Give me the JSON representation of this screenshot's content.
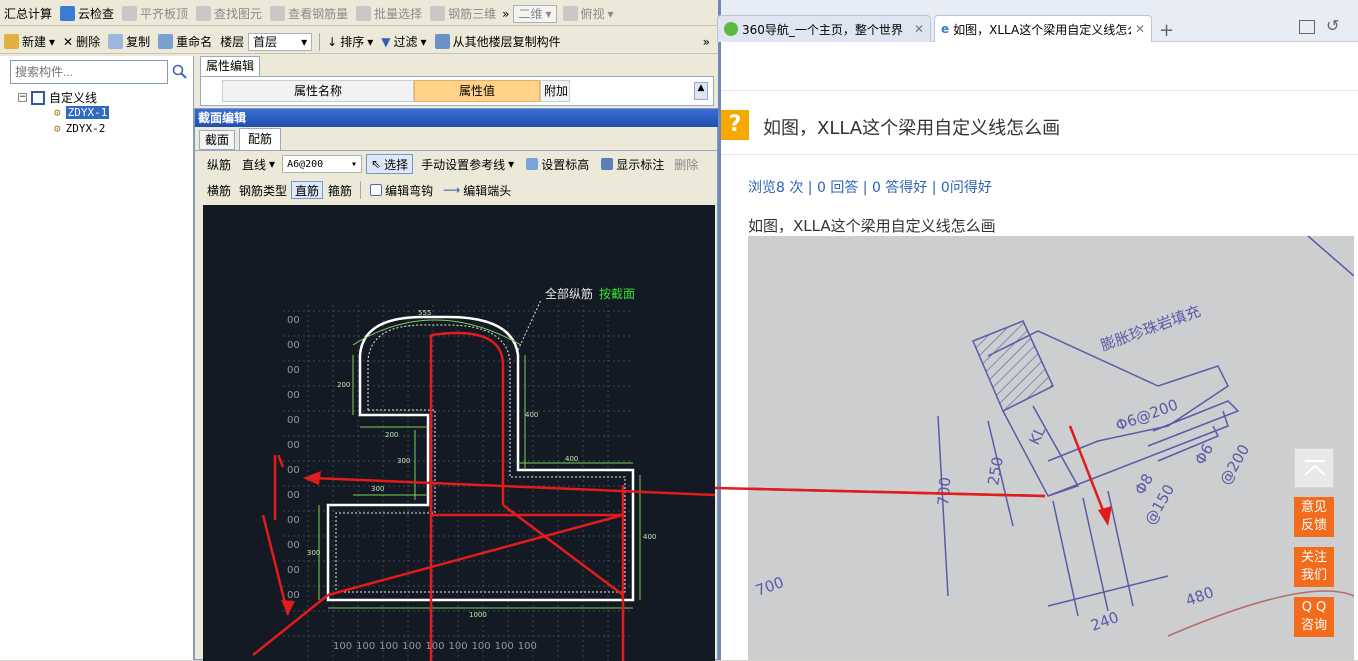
{
  "left_app": {
    "toolbar1": {
      "items": [
        "汇总计算",
        "云检查",
        "平齐板顶",
        "查找图元",
        "查看钢筋量",
        "批量选择",
        "钢筋三维"
      ],
      "view_mode": "二维",
      "view_dir": "俯视"
    },
    "toolbar2": {
      "items": [
        "新建",
        "删除",
        "复制",
        "重命名"
      ],
      "floor_label": "楼层",
      "floor_value": "首层",
      "sort": "排序",
      "filter": "过滤",
      "copy_from": "从其他楼层复制构件"
    },
    "tree": {
      "search_placeholder": "搜索构件...",
      "root": "自定义线",
      "children": [
        "ZDYX-1",
        "ZDYX-2"
      ]
    },
    "props": {
      "tab": "属性编辑",
      "col_name": "属性名称",
      "col_value": "属性值",
      "col_extra": "附加"
    },
    "section_editor": {
      "title": "截面编辑",
      "tabs": [
        "截面",
        "配筋"
      ],
      "row1": {
        "long_bar": "纵筋",
        "line_type": "直线",
        "spec": "A6@200",
        "select": "选择",
        "ref_line": "手动设置参考线",
        "set_height": "设置标高",
        "show_label": "显示标注",
        "delete": "删除"
      },
      "row2": {
        "hoop": "横筋",
        "type_label": "钢筋类型",
        "straight": "直筋",
        "stirrup": "箍筋",
        "edit_hook": "编辑弯钩",
        "edit_end": "编辑端头"
      },
      "canvas": {
        "all_bars": "全部纵筋",
        "by_section": "按截面",
        "dims": [
          "555",
          "200",
          "400",
          "200",
          "300",
          "400",
          "300",
          "400",
          "300",
          "1000"
        ],
        "grid_left": [
          "00",
          "00",
          "00",
          "00",
          "00",
          "00",
          "00",
          "00",
          "00",
          "00",
          "00",
          "00"
        ],
        "grid_bottom": [
          "100",
          "100",
          "100",
          "100",
          "100",
          "100",
          "100",
          "100",
          "100"
        ]
      }
    }
  },
  "browser": {
    "tabs": [
      {
        "title": "360导航_一个主页，整个世界",
        "active": false
      },
      {
        "title": "如图，XLLA这个梁用自定义线怎么",
        "active": true
      }
    ],
    "question_title": "如图，XLLA这个梁用自定义线怎么画",
    "stats": "浏览8 次 | 0 回答 | 0 答得好 | 0问得好",
    "body": "如图，XLLA这个梁用自定义线怎么画",
    "side_buttons": [
      "意见\n反馈",
      "关注\n我们",
      "Q Q\n咨询"
    ],
    "colors": {
      "accent": "#f36b1c",
      "link": "#2d64b3",
      "cad_bg": "#141a24"
    }
  }
}
